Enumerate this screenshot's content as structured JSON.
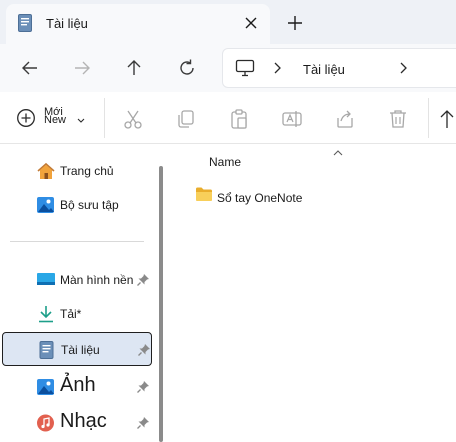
{
  "tab": {
    "title": "Tài liệu",
    "close_icon": "close-icon",
    "new_tab_icon": "plus-icon"
  },
  "nav": {
    "back_icon": "arrow-left-icon",
    "forward_icon": "arrow-right-icon",
    "up_icon": "arrow-up-icon",
    "refresh_icon": "refresh-icon"
  },
  "address": {
    "root_icon": "monitor-icon",
    "crumb": "Tài liệu"
  },
  "toolbar": {
    "new_label_top": "Mới",
    "new_label_bottom": "New",
    "icons": [
      "cut-icon",
      "copy-icon",
      "paste-icon",
      "rename-icon",
      "share-icon",
      "delete-icon",
      "sort-icon"
    ]
  },
  "sidebar": {
    "items": [
      {
        "label": "Trang chủ",
        "icon": "home-icon",
        "pinned": false
      },
      {
        "label": "Bộ sưu tập",
        "icon": "gallery-icon",
        "pinned": false
      },
      {
        "label": "Màn hình nền",
        "icon": "desktop-icon",
        "pinned": true
      },
      {
        "label": "Tải*",
        "icon": "download-icon",
        "pinned": true
      },
      {
        "label": "Tài liệu",
        "icon": "documents-icon",
        "pinned": true,
        "selected": true
      },
      {
        "label": "Ảnh",
        "icon": "pictures-icon",
        "pinned": true
      },
      {
        "label": "Nhạc",
        "icon": "music-icon",
        "pinned": true
      }
    ]
  },
  "main": {
    "column_header": "Name",
    "rows": [
      {
        "name": "Sổ tay OneNote",
        "icon": "folder-icon"
      }
    ]
  },
  "colors": {
    "accent": "#0067c0",
    "selected_bg": "#dde6f3",
    "folder": "#f3c44b"
  }
}
